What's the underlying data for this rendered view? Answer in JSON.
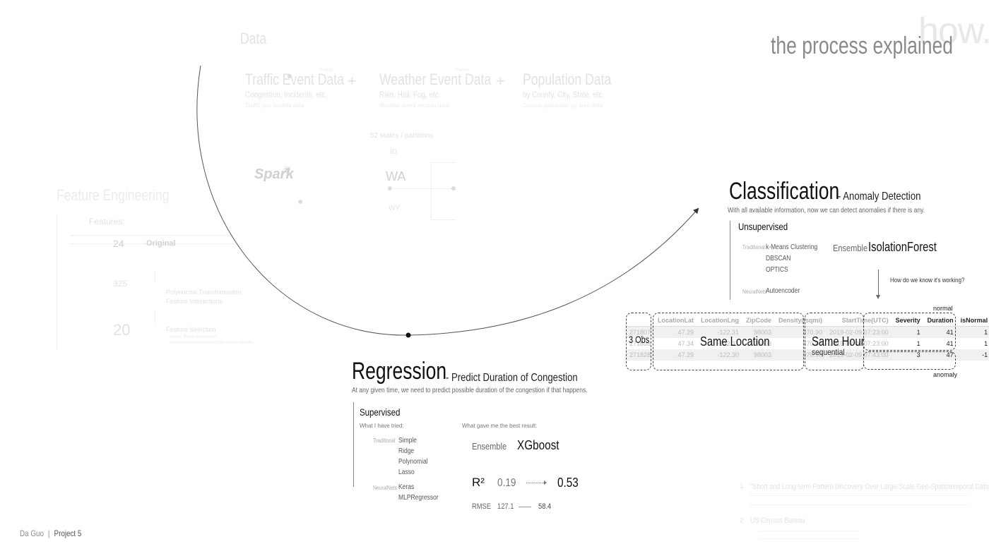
{
  "header": {
    "how": "how.",
    "title": "the process explained"
  },
  "footer": {
    "author": "Da Guo",
    "separator": "|",
    "project": "Project 5"
  },
  "background": {
    "data_title": "Data",
    "sources": [
      {
        "title": "Traffic Event Data",
        "sub": "Congestion, Incidents, etc.",
        "note": "Traffic jam records data",
        "badge": "Public"
      },
      {
        "title": "Weather Event Data",
        "sub": "Rain, Hail, Fog, etc.",
        "note": "Weather event records data",
        "badge": "Public"
      },
      {
        "title": "Population Data",
        "sub": "by County, City, State, etc.",
        "note": "Census population by area data"
      }
    ],
    "plus": "+",
    "states_label": "52 states / partitions",
    "states": [
      "ID",
      "WA",
      "WY"
    ],
    "spark_label": "Spark",
    "fe_title": "Feature Engineering",
    "features_label": "Features:",
    "feature_counts": [
      "24",
      "325",
      "20"
    ],
    "original_label": "Original",
    "poly_label": "Polynomial Transformation",
    "poly_sub": "Feature Interactions",
    "selection_label": "Feature Selection",
    "selection_sub1": "Lasso, Ridge Regression",
    "selection_sub2": "Feature Importance from tree-based models",
    "refs": [
      {
        "num": "1",
        "title": "\"Short and Long-term Pattern Discovery Over Large-Scale Geo-Spatiotemporal Data.\""
      },
      {
        "num": "2",
        "title": "US Census Bureau"
      }
    ]
  },
  "classification": {
    "title": "Classification",
    "subtitle": "- Anomaly Detection",
    "desc": "With all available information, now we can detect anomalies if there is any.",
    "section": "Unsupervised",
    "groups": [
      {
        "label": "Traditional",
        "methods": [
          "k-Means Clustering",
          "DBSCAN",
          "OPTICS"
        ]
      },
      {
        "label": "NeuralNets",
        "methods": [
          "Autoencoder"
        ]
      }
    ],
    "ensemble_label": "Ensemble",
    "ensemble_value": "IsolationForest",
    "question": "How do we know it's working?",
    "normal_label": "normal",
    "anomaly_label": "anomaly",
    "overlay_obs": "3 Obs",
    "overlay_location": "Same Location",
    "overlay_hour": "Same Hour",
    "overlay_hour_sub": "sequential",
    "table": {
      "columns": [
        "",
        "LocationLat",
        "LocationLng",
        "ZipCode",
        "Density(/sqmi)",
        "StartTime(UTC)",
        "Severity",
        "Duration",
        "isNormal"
      ],
      "rows": [
        [
          "271807",
          "47.29",
          "-122.31",
          "98003",
          "870.90",
          "2019-02-09 07:23:00",
          "1",
          "41",
          "1"
        ],
        [
          "271808",
          "47.34",
          "-122.31",
          "98003",
          "870.90",
          "2019-02-09 07:23:00",
          "1",
          "41",
          "1"
        ],
        [
          "271828",
          "47.29",
          "-122.30",
          "98003",
          "870.90",
          "2019-02-09 07:43:00",
          "3",
          "47",
          "-1"
        ]
      ]
    }
  },
  "regression": {
    "title": "Regression",
    "subtitle": "- Predict Duration of Congestion",
    "desc": "At any given time, we need to predict possible duration of the congestion if that happens.",
    "section": "Supervised",
    "tried_label": "What I have tried:",
    "best_label": "What gave me the best result:",
    "groups": [
      {
        "label": "Traditional",
        "methods": [
          "Simple",
          "Ridge",
          "Polynomial",
          "Lasso"
        ]
      },
      {
        "label": "NeuralNets",
        "methods": [
          "Keras",
          "MLPRegressor"
        ]
      }
    ],
    "ensemble_label": "Ensemble",
    "ensemble_value": "XGboost",
    "r2_label": "R²",
    "r2_from": "0.19",
    "r2_to": "0.53",
    "rmse_label": "RMSE",
    "rmse_from": "127.1",
    "rmse_to": "58.4"
  }
}
